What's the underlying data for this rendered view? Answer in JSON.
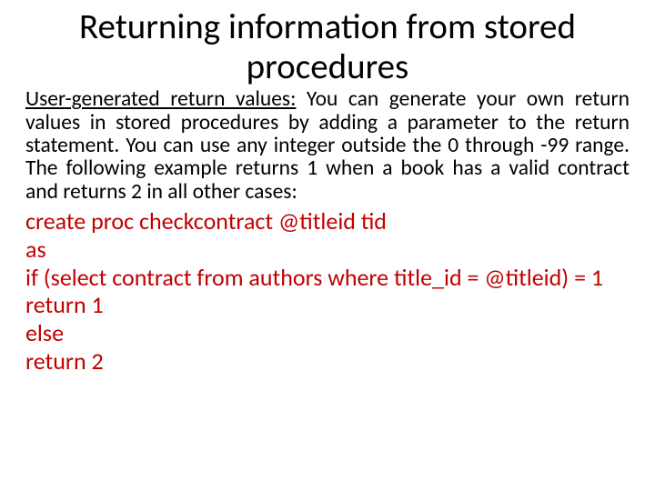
{
  "title": "Returning information from stored procedures",
  "paragraph": {
    "lead_underlined": "User-generated return values:",
    "rest": " You can generate your own return values in stored procedures by adding a parameter to the return statement. You can use any integer outside the 0 through -99 range. The following example returns 1 when a book has a valid contract and returns 2 in all other cases:"
  },
  "code": {
    "l1": "create proc checkcontract @titleid tid",
    "l2": "as",
    "l3": "if (select contract from authors where title_id = @titleid) = 1",
    "l4": "return 1",
    "l5": "else",
    "l6": "return 2"
  }
}
